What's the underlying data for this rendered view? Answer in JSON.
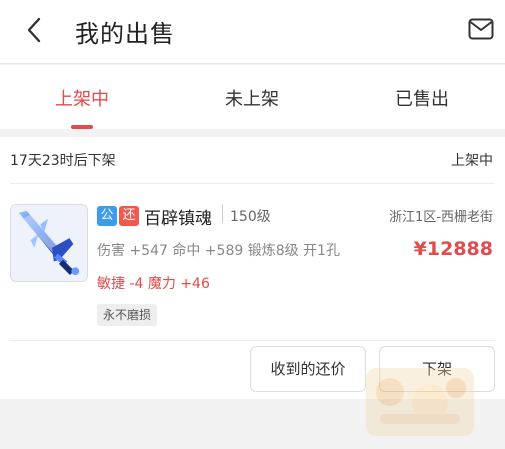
{
  "header": {
    "back_icon": "chevron-left-icon",
    "title": "我的出售",
    "mail_icon": "mail-icon"
  },
  "tabs": [
    {
      "label": "上架中",
      "active": true
    },
    {
      "label": "未上架",
      "active": false
    },
    {
      "label": "已售出",
      "active": false
    }
  ],
  "listing": {
    "time_remaining": "17天23时后下架",
    "status": "上架中",
    "badges": [
      "公",
      "还"
    ],
    "item_name": "百辟镇魂",
    "level": "150级",
    "server": "浙江1区-西栅老街",
    "stats": "伤害 +547 命中 +589 锻炼8级 开1孔",
    "price": "¥12888",
    "extra_stats": "敏捷 -4 魔力 +46",
    "tag": "永不磨损",
    "actions": {
      "offers_label": "收到的还价",
      "delist_label": "下架"
    }
  },
  "colors": {
    "accent": "#e24b4b",
    "badge_gong": "#3d9be9",
    "badge_huan": "#ef5a4f"
  }
}
